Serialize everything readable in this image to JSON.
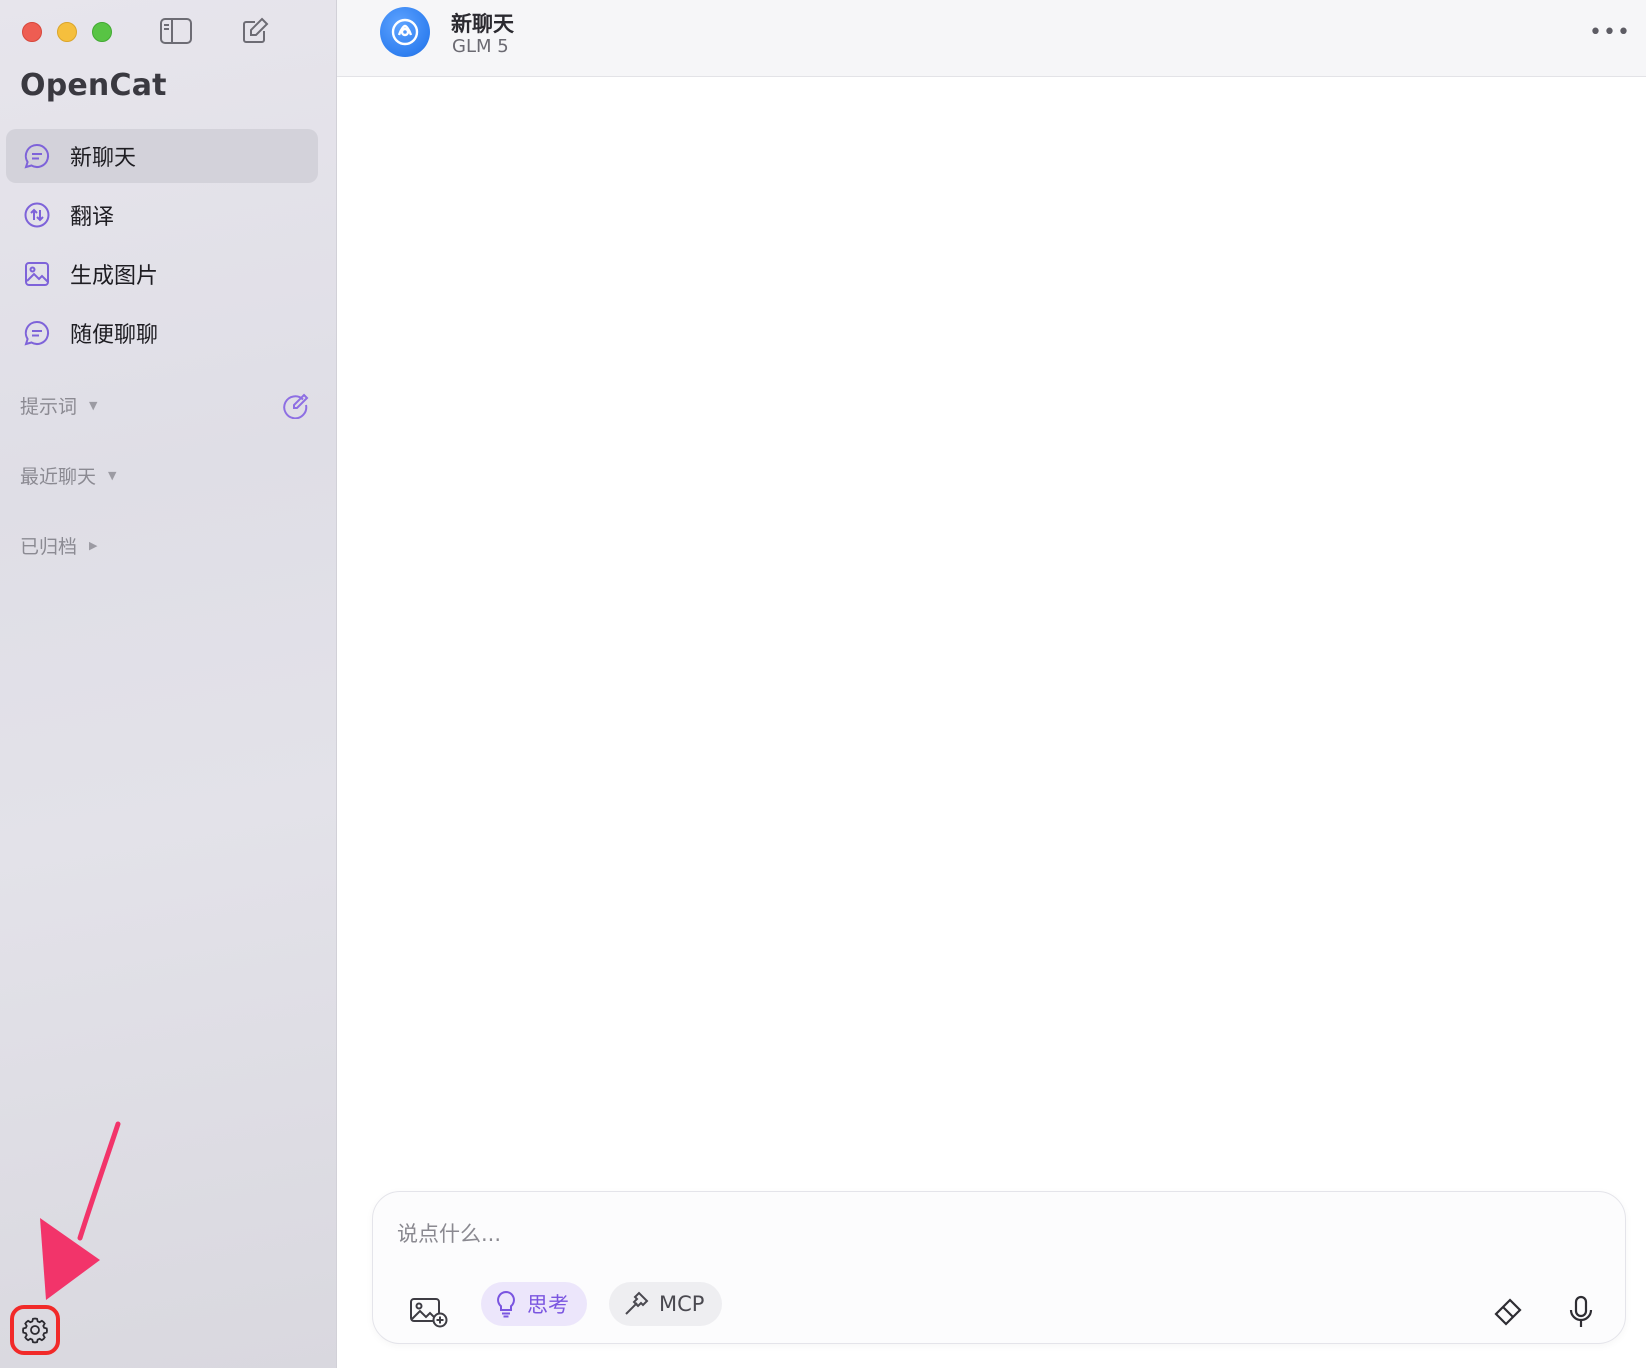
{
  "app": {
    "title": "OpenCat"
  },
  "sidebar": {
    "nav_items": [
      {
        "label": "新聊天",
        "icon": "chat-bubble-icon",
        "active": true
      },
      {
        "label": "翻译",
        "icon": "translate-icon",
        "active": false
      },
      {
        "label": "生成图片",
        "icon": "image-icon",
        "active": false
      },
      {
        "label": "随便聊聊",
        "icon": "chat-bubble-icon",
        "active": false
      }
    ],
    "sections": {
      "prompts": {
        "label": "提示词",
        "caret": "▼"
      },
      "recent": {
        "label": "最近聊天",
        "caret": "▼"
      },
      "archived": {
        "label": "已归档",
        "caret": "▶"
      }
    }
  },
  "chat": {
    "title": "新聊天",
    "model": "GLM 5",
    "more_label": "•••"
  },
  "composer": {
    "placeholder": "说点什么...",
    "value": "",
    "think_label": "思考",
    "mcp_label": "MCP"
  },
  "colors": {
    "accent": "#7a55e0",
    "sidebar_bg": "#e3e2e9",
    "annotation": "#f12a29",
    "arrow": "#f2346a"
  }
}
